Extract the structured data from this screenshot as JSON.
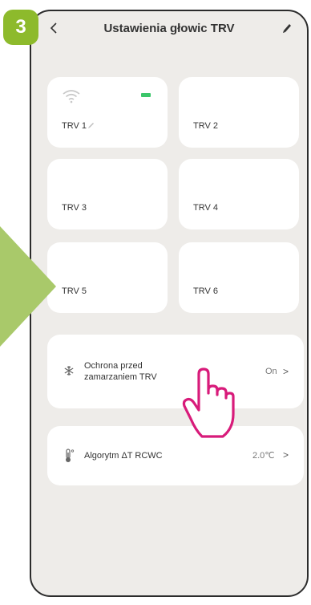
{
  "step_badge": "3",
  "header": {
    "back_icon": "chevron-left-icon",
    "title": "Ustawienia głowic TRV",
    "edit_icon": "pencil-icon"
  },
  "tiles": [
    {
      "label": "TRV 1",
      "icons": [
        "wifi-icon",
        "battery-icon",
        "pencil-icon"
      ]
    },
    {
      "label": "TRV 2"
    },
    {
      "label": "TRV 3"
    },
    {
      "label": "TRV 4"
    },
    {
      "label": "TRV 5"
    },
    {
      "label": "TRV 6"
    }
  ],
  "settings": [
    {
      "icon": "snowflake-icon",
      "label_line1": "Ochrona przed",
      "label_line2": "zamarzaniem TRV",
      "value": "On",
      "chevron": ">"
    },
    {
      "icon": "thermometer-icon",
      "label": "Algorytm ΔT RCWC",
      "value": "2.0℃",
      "chevron": ">"
    }
  ],
  "colors": {
    "accent_green": "#8dba2c",
    "battery_green": "#3bc66a",
    "hand_pointer": "#d81b7a",
    "screen_background": "#eeece9"
  },
  "overlay": {
    "arrow": "green-arrow",
    "pointer": "hand-pointer-icon"
  }
}
